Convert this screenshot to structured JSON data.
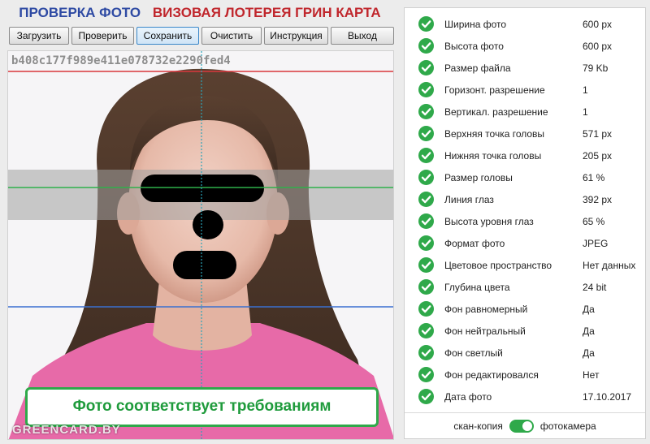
{
  "header": {
    "title_left": "ПРОВЕРКА ФОТО",
    "title_right": "ВИЗОВАЯ ЛОТЕРЕЯ ГРИН КАРТА"
  },
  "toolbar": {
    "load": "Загрузить",
    "check": "Проверить",
    "save": "Сохранить",
    "clear": "Очистить",
    "help": "Инструкция",
    "exit": "Выход"
  },
  "photo": {
    "hash": "b408c177f989e411e078732e2290fed4",
    "status": "Фото соответствует требованиям",
    "watermark": "GREENCARD.BY"
  },
  "colors": {
    "ok_green": "#2fa94a",
    "title_blue": "#2e4aa3",
    "title_red": "#c0262c",
    "top_line": "#d9373c",
    "eye_line": "#2fb04b",
    "chin_line": "#3a6fd0"
  },
  "results": [
    {
      "icon": "check-icon",
      "label": "Ширина фото",
      "value": "600 px"
    },
    {
      "icon": "check-icon",
      "label": "Высота фото",
      "value": "600 px"
    },
    {
      "icon": "check-icon",
      "label": "Размер файла",
      "value": "79 Kb"
    },
    {
      "icon": "check-icon",
      "label": "Горизонт. разрешение",
      "value": "1"
    },
    {
      "icon": "check-icon",
      "label": "Вертикал. разрешение",
      "value": "1"
    },
    {
      "icon": "check-icon",
      "label": "Верхняя точка головы",
      "value": "571 px"
    },
    {
      "icon": "check-icon",
      "label": "Нижняя точка головы",
      "value": "205 px"
    },
    {
      "icon": "check-icon",
      "label": "Размер головы",
      "value": "61 %"
    },
    {
      "icon": "check-icon",
      "label": "Линия глаз",
      "value": "392 px"
    },
    {
      "icon": "check-icon",
      "label": "Высота уровня глаз",
      "value": "65 %"
    },
    {
      "icon": "check-icon",
      "label": "Формат фото",
      "value": "JPEG"
    },
    {
      "icon": "check-icon",
      "label": "Цветовое пространство",
      "value": "Нет данных"
    },
    {
      "icon": "check-icon",
      "label": "Глубина цвета",
      "value": "24 bit"
    },
    {
      "icon": "check-icon",
      "label": "Фон равномерный",
      "value": "Да"
    },
    {
      "icon": "check-icon",
      "label": "Фон нейтральный",
      "value": "Да"
    },
    {
      "icon": "check-icon",
      "label": "Фон светлый",
      "value": "Да"
    },
    {
      "icon": "check-icon",
      "label": "Фон редактировался",
      "value": "Нет"
    },
    {
      "icon": "check-icon",
      "label": "Дата фото",
      "value": "17.10.2017"
    }
  ],
  "source_toggle": {
    "left_label": "скан-копия",
    "right_label": "фотокамера",
    "state": "фотокамера"
  }
}
